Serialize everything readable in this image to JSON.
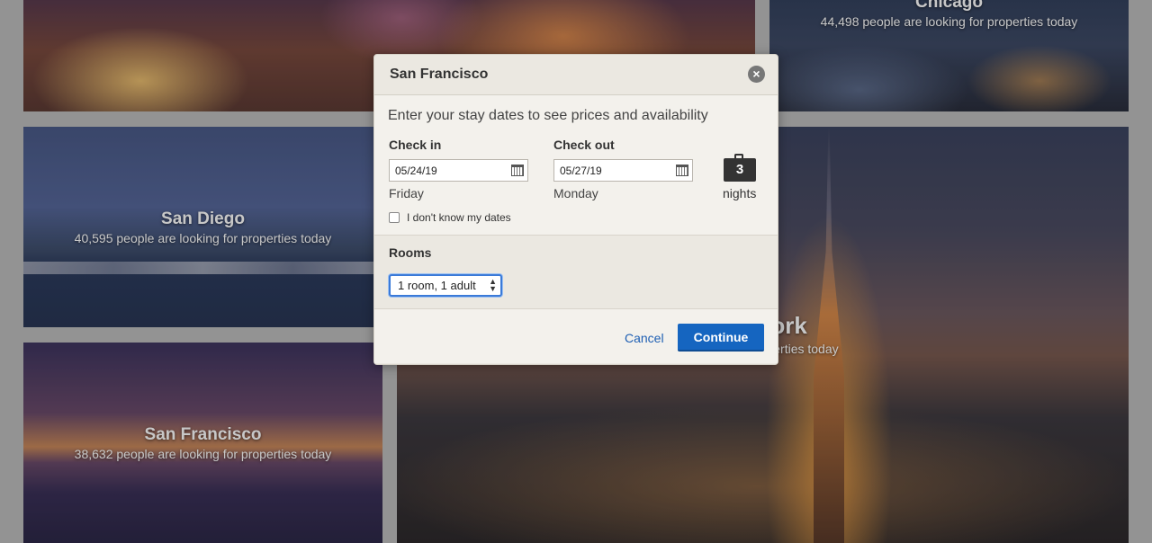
{
  "tiles": {
    "vegas": {
      "city": "",
      "count": ""
    },
    "chicago": {
      "city": "Chicago",
      "count": "44,498 people are looking for properties today"
    },
    "sandiego": {
      "city": "San Diego",
      "count": "40,595 people are looking for properties today"
    },
    "sanfrancisco": {
      "city": "San Francisco",
      "count": "38,632 people are looking for properties today"
    },
    "newyork": {
      "city": "York",
      "count": "for properties today"
    }
  },
  "modal": {
    "title": "San Francisco",
    "prompt": "Enter your stay dates to see prices and availability",
    "checkin": {
      "label": "Check in",
      "value": "05/24/19",
      "day": "Friday"
    },
    "checkout": {
      "label": "Check out",
      "value": "05/27/19",
      "day": "Monday"
    },
    "nights": {
      "count": "3",
      "label": "nights"
    },
    "unknown_dates_label": "I don't know my dates",
    "rooms": {
      "label": "Rooms",
      "selected": "1 room, 1 adult"
    },
    "cancel_label": "Cancel",
    "continue_label": "Continue"
  },
  "colors": {
    "primary_button": "#1565c0",
    "link": "#1e5fb3",
    "modal_bg": "#ebe8e1"
  }
}
